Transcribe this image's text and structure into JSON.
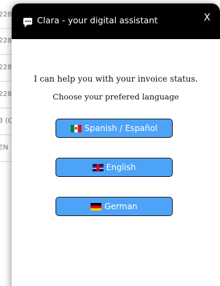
{
  "background_rows": [
    {
      "text": "228"
    },
    {
      "text": "228"
    },
    {
      "text": "228"
    },
    {
      "text": "228"
    },
    {
      "text": "3 (C"
    },
    {
      "text": "EN"
    }
  ],
  "chat": {
    "title": "Clara - your digital assistant",
    "close_label": "X",
    "line1": "I can help you with your invoice status.",
    "line2": "Choose your prefered language",
    "buttons": [
      {
        "label": "Spanish / Español",
        "flag": "mexico-flag-icon"
      },
      {
        "label": "English",
        "flag": "uk-flag-icon"
      },
      {
        "label": "German",
        "flag": "germany-flag-icon"
      }
    ]
  },
  "colors": {
    "header_bg": "#000000",
    "button_bg": "#4da3f7",
    "button_border": "#1a1a1a"
  }
}
